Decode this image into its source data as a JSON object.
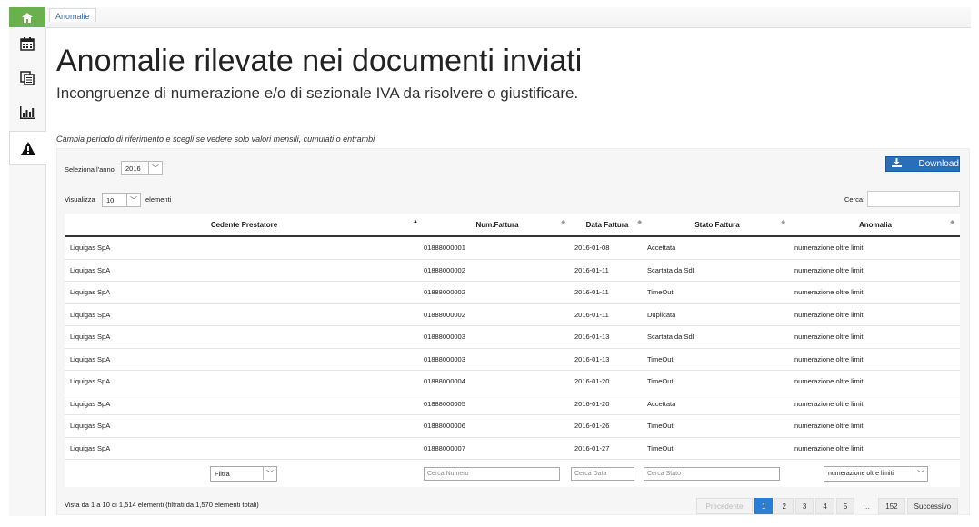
{
  "tabs": [
    {
      "label": "Anomalie"
    }
  ],
  "header": {
    "title": "Anomalie rilevate nei documenti inviati",
    "subtitle": "Incongruenze di numerazione e/o di sezionale IVA da risolvere o giustificare.",
    "hint": "Cambia periodo di riferimento e scegli se vedere solo valori mensili, cumulati o entrambi"
  },
  "controls": {
    "year_label": "Seleziona l'anno",
    "year_value": "2016",
    "show_label": "Visualizza",
    "show_value": "10",
    "show_suffix": "elementi",
    "search_label": "Cerca:",
    "download_label": "Download"
  },
  "table": {
    "columns": [
      "Cedente Prestatore",
      "Num.Fattura",
      "Data Fattura",
      "Stato Fattura",
      "Anomalia"
    ],
    "rows": [
      [
        "Liquigas SpA",
        "01888000001",
        "2016-01-08",
        "Accettata",
        "numerazione oltre limiti"
      ],
      [
        "Liquigas SpA",
        "01888000002",
        "2016-01-11",
        "Scartata da SdI",
        "numerazione oltre limiti"
      ],
      [
        "Liquigas SpA",
        "01888000002",
        "2016-01-11",
        "TimeOut",
        "numerazione oltre limiti"
      ],
      [
        "Liquigas SpA",
        "01888000002",
        "2016-01-11",
        "Duplicata",
        "numerazione oltre limiti"
      ],
      [
        "Liquigas SpA",
        "01888000003",
        "2016-01-13",
        "Scartata da SdI",
        "numerazione oltre limiti"
      ],
      [
        "Liquigas SpA",
        "01888000003",
        "2016-01-13",
        "TimeOut",
        "numerazione oltre limiti"
      ],
      [
        "Liquigas SpA",
        "01888000004",
        "2016-01-20",
        "TimeOut",
        "numerazione oltre limiti"
      ],
      [
        "Liquigas SpA",
        "01888000005",
        "2016-01-20",
        "Accettata",
        "numerazione oltre limiti"
      ],
      [
        "Liquigas SpA",
        "01888000006",
        "2016-01-26",
        "TimeOut",
        "numerazione oltre limiti"
      ],
      [
        "Liquigas SpA",
        "01888000007",
        "2016-01-27",
        "TimeOut",
        "numerazione oltre limiti"
      ]
    ],
    "filters": {
      "cedente": "Filtra",
      "numero": "Cerca Numero",
      "data": "Cerca Data",
      "stato": "Cerca Stato",
      "anomalia": "numerazione oltre limiti"
    }
  },
  "footer": {
    "info": "Vista da 1 a 10 di 1,514 elementi (filtrati da 1,570 elementi totali)",
    "pagination": {
      "prev": "Precedente",
      "pages": [
        "1",
        "2",
        "3",
        "4",
        "5"
      ],
      "ellipsis": "…",
      "last": "152",
      "next": "Successivo"
    }
  },
  "icons": [
    "home-icon",
    "calendar-icon",
    "documents-icon",
    "bar-chart-icon",
    "warning-icon",
    "download-icon"
  ],
  "colors": {
    "home_green": "#6ab04c",
    "primary_blue": "#2a6db8",
    "page_active": "#2a7fd4"
  }
}
